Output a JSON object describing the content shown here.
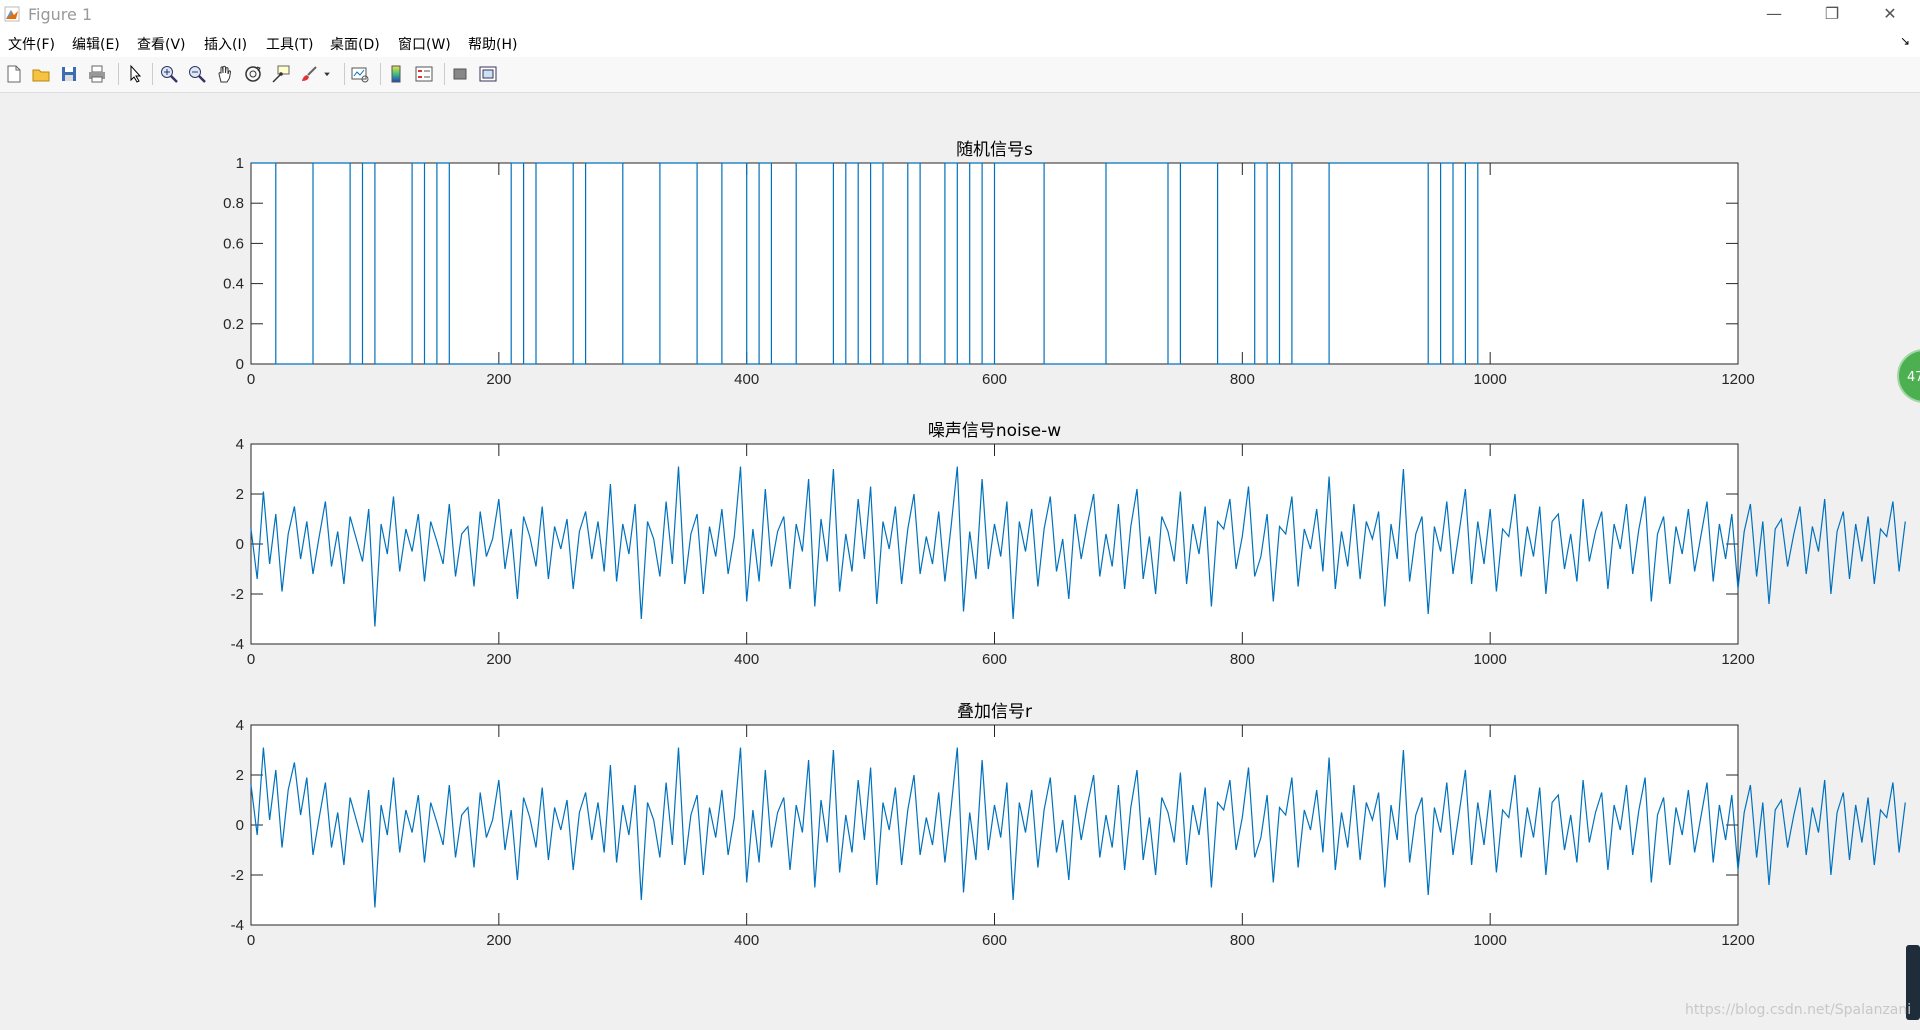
{
  "window": {
    "title": "Figure 1",
    "controls": [
      "—",
      "❐",
      "✕"
    ]
  },
  "menu": {
    "items": [
      "文件(F)",
      "编辑(E)",
      "查看(V)",
      "插入(I)",
      "工具(T)",
      "桌面(D)",
      "窗口(W)",
      "帮助(H)"
    ],
    "dock_arrow": "↘"
  },
  "toolbar": {
    "icons": [
      "new-figure-icon",
      "open-file-icon",
      "save-icon",
      "print-icon",
      "select-arrow-icon",
      "zoom-in-icon",
      "zoom-out-icon",
      "pan-hand-icon",
      "rotate-3d-icon",
      "data-cursor-icon",
      "brush-icon",
      "link-plot-icon",
      "colorbar-icon",
      "legend-icon",
      "hide-plot-tools-icon",
      "show-plot-tools-icon"
    ]
  },
  "overlay": {
    "badge": "47",
    "watermark": "https://blog.csdn.net/Spalanzani"
  },
  "chart_data": [
    {
      "type": "line",
      "title": "随机信号s",
      "xlim": [
        0,
        1200
      ],
      "ylim": [
        0,
        1
      ],
      "xticks": [
        "0",
        "200",
        "400",
        "600",
        "800",
        "1000",
        "1200"
      ],
      "yticks": [
        "0",
        "0.2",
        "0.4",
        "0.6",
        "0.8",
        "1"
      ],
      "color": "#0072bd",
      "step": true,
      "x": [
        0,
        20,
        50,
        80,
        90,
        100,
        130,
        140,
        150,
        160,
        210,
        220,
        230,
        260,
        270,
        300,
        330,
        360,
        380,
        400,
        410,
        420,
        440,
        470,
        480,
        490,
        500,
        510,
        530,
        540,
        560,
        570,
        580,
        590,
        600,
        640,
        690,
        740,
        750,
        780,
        810,
        820,
        830,
        840,
        870,
        950,
        960,
        970,
        980,
        990
      ],
      "y": [
        1,
        0,
        1,
        0,
        1,
        0,
        1,
        0,
        1,
        0,
        1,
        0,
        1,
        0,
        1,
        0,
        1,
        0,
        1,
        0,
        1,
        0,
        1,
        0,
        1,
        0,
        1,
        0,
        1,
        0,
        1,
        0,
        1,
        0,
        1,
        0,
        1,
        0,
        1,
        0,
        1,
        0,
        1,
        0,
        1,
        0,
        1,
        0,
        1,
        0
      ]
    },
    {
      "type": "line",
      "title": "噪声信号noise-w",
      "xlim": [
        0,
        1200
      ],
      "ylim": [
        -4,
        4
      ],
      "xticks": [
        "0",
        "200",
        "400",
        "600",
        "800",
        "1000",
        "1200"
      ],
      "yticks": [
        "-4",
        "-2",
        "0",
        "2",
        "4"
      ],
      "color": "#0072bd",
      "x_start": 0,
      "x_step": 5,
      "values": [
        0.6,
        -1.4,
        2.1,
        -0.8,
        1.2,
        -1.9,
        0.4,
        1.5,
        -0.6,
        0.9,
        -1.2,
        0.3,
        1.7,
        -0.9,
        0.5,
        -1.6,
        1.1,
        0.2,
        -0.7,
        1.4,
        -3.3,
        0.8,
        -0.4,
        1.9,
        -1.1,
        0.6,
        -0.3,
        1.2,
        -1.5,
        0.9,
        0.1,
        -0.8,
        1.6,
        -1.3,
        0.4,
        0.7,
        -1.7,
        1.3,
        -0.5,
        0.2,
        1.8,
        -1.0,
        0.6,
        -2.2,
        1.1,
        0.3,
        -0.9,
        1.5,
        -1.4,
        0.7,
        -0.2,
        1.0,
        -1.8,
        0.5,
        1.3,
        -0.6,
        0.9,
        -1.1,
        2.4,
        -1.5,
        0.8,
        -0.4,
        1.6,
        -3.0,
        0.9,
        0.2,
        -1.3,
        1.7,
        -0.8,
        3.1,
        -1.6,
        0.4,
        1.2,
        -2.0,
        0.7,
        -0.5,
        1.4,
        -1.2,
        0.3,
        3.1,
        -2.3,
        0.6,
        -1.5,
        2.2,
        -0.9,
        0.5,
        1.1,
        -1.8,
        0.8,
        -0.3,
        2.6,
        -2.5,
        1.0,
        -0.7,
        3.0,
        -1.9,
        0.4,
        -1.1,
        1.8,
        -0.6,
        2.3,
        -2.4,
        0.9,
        -0.2,
        1.5,
        -1.6,
        0.6,
        2.0,
        -1.2,
        0.3,
        -0.8,
        1.3,
        -1.5,
        0.7,
        3.1,
        -2.7,
        0.5,
        -1.4,
        2.6,
        -1.0,
        0.8,
        -0.5,
        1.7,
        -3.0,
        0.9,
        -0.3,
        1.4,
        -1.7,
        0.6,
        1.9,
        -1.1,
        0.2,
        -2.2,
        1.2,
        -0.6,
        0.8,
        2.0,
        -1.3,
        0.4,
        -0.9,
        1.6,
        -1.8,
        0.7,
        2.2,
        -1.4,
        0.3,
        -2.0,
        1.1,
        0.5,
        -0.7,
        2.1,
        -1.6,
        0.8,
        -0.4,
        1.5,
        -2.5,
        0.9,
        0.6,
        1.8,
        -1.0,
        0.3,
        2.3,
        -1.3,
        -0.5,
        1.2,
        -2.3,
        0.7,
        0.4,
        1.9,
        -1.7,
        0.6,
        -0.2,
        1.4,
        -1.1,
        2.7,
        -1.8,
        0.5,
        -0.9,
        1.6,
        -1.4,
        0.9,
        0.2,
        1.3,
        -2.5,
        0.8,
        -0.6,
        3.0,
        -1.5,
        0.4,
        1.1,
        -2.8,
        0.7,
        -0.3,
        1.7,
        -1.2,
        0.5,
        2.2,
        -1.6,
        0.9,
        -0.8,
        1.4,
        -1.9,
        0.6,
        0.3,
        2.0,
        -1.3,
        0.7,
        -0.5,
        1.5,
        -2.0,
        0.9,
        1.2,
        -1.0,
        0.4,
        -1.5,
        1.8,
        -0.7,
        0.5,
        1.3,
        -1.8,
        0.8,
        -0.2,
        1.6,
        -1.2,
        0.6,
        1.9,
        -2.3,
        0.4,
        1.1,
        -1.6,
        0.7,
        -0.4,
        1.4,
        -1.1,
        0.3,
        1.7,
        -1.5,
        0.8,
        -0.6,
        1.2,
        -1.8,
        0.5,
        1.6,
        -1.3,
        0.9,
        -2.4,
        0.6,
        1.0,
        -0.9,
        0.4,
        1.5,
        -1.2,
        0.7,
        -0.3,
        1.8,
        -2.0,
        0.5,
        1.3,
        -1.4,
        0.8,
        -0.7,
        1.1,
        -1.6,
        0.6,
        0.3,
        1.7,
        -1.1,
        0.9
      ]
    },
    {
      "type": "line",
      "title": "叠加信号r",
      "xlim": [
        0,
        1200
      ],
      "ylim": [
        -4,
        4
      ],
      "xticks": [
        "0",
        "200",
        "400",
        "600",
        "800",
        "1000",
        "1200"
      ],
      "yticks": [
        "-4",
        "-2",
        "0",
        "2",
        "4"
      ],
      "color": "#0072bd",
      "x_start": 0,
      "x_step": 5,
      "values": [
        1.6,
        -0.4,
        3.1,
        0.2,
        2.2,
        -0.9,
        1.4,
        2.5,
        0.4,
        1.9,
        -1.2,
        0.3,
        1.7,
        -0.9,
        0.5,
        -1.6,
        1.1,
        0.2,
        -0.7,
        1.4,
        -3.3,
        0.8,
        -0.4,
        1.9,
        -1.1,
        0.6,
        -0.3,
        1.2,
        -1.5,
        0.9,
        0.1,
        -0.8,
        1.6,
        -1.3,
        0.4,
        0.7,
        -1.7,
        1.3,
        -0.5,
        0.2,
        1.8,
        -1.0,
        0.6,
        -2.2,
        1.1,
        0.3,
        -0.9,
        1.5,
        -1.4,
        0.7,
        -0.2,
        1.0,
        -1.8,
        0.5,
        1.3,
        -0.6,
        0.9,
        -1.1,
        2.4,
        -1.5,
        0.8,
        -0.4,
        1.6,
        -3.0,
        0.9,
        0.2,
        -1.3,
        1.7,
        -0.8,
        3.1,
        -1.6,
        0.4,
        1.2,
        -2.0,
        0.7,
        -0.5,
        1.4,
        -1.2,
        0.3,
        3.1,
        -2.3,
        0.6,
        -1.5,
        2.2,
        -0.9,
        0.5,
        1.1,
        -1.8,
        0.8,
        -0.3,
        2.6,
        -2.5,
        1.0,
        -0.7,
        3.0,
        -1.9,
        0.4,
        -1.1,
        1.8,
        -0.6,
        2.3,
        -2.4,
        0.9,
        -0.2,
        1.5,
        -1.6,
        0.6,
        2.0,
        -1.2,
        0.3,
        -0.8,
        1.3,
        -1.5,
        0.7,
        3.1,
        -2.7,
        0.5,
        -1.4,
        2.6,
        -1.0,
        0.8,
        -0.5,
        1.7,
        -3.0,
        0.9,
        -0.3,
        1.4,
        -1.7,
        0.6,
        1.9,
        -1.1,
        0.2,
        -2.2,
        1.2,
        -0.6,
        0.8,
        2.0,
        -1.3,
        0.4,
        -0.9,
        1.6,
        -1.8,
        0.7,
        2.2,
        -1.4,
        0.3,
        -2.0,
        1.1,
        0.5,
        -0.7,
        2.1,
        -1.6,
        0.8,
        -0.4,
        1.5,
        -2.5,
        0.9,
        0.6,
        1.8,
        -1.0,
        0.3,
        2.3,
        -1.3,
        -0.5,
        1.2,
        -2.3,
        0.7,
        0.4,
        1.9,
        -1.7,
        0.6,
        -0.2,
        1.4,
        -1.1,
        2.7,
        -1.8,
        0.5,
        -0.9,
        1.6,
        -1.4,
        0.9,
        0.2,
        1.3,
        -2.5,
        0.8,
        -0.6,
        3.0,
        -1.5,
        0.4,
        1.1,
        -2.8,
        0.7,
        -0.3,
        1.7,
        -1.2,
        0.5,
        2.2,
        -1.6,
        0.9,
        -0.8,
        1.4,
        -1.9,
        0.6,
        0.3,
        2.0,
        -1.3,
        0.7,
        -0.5,
        1.5,
        -2.0,
        0.9,
        1.2,
        -1.0,
        0.4,
        -1.5,
        1.8,
        -0.7,
        0.5,
        1.3,
        -1.8,
        0.8,
        -0.2,
        1.6,
        -1.2,
        0.6,
        1.9,
        -2.3,
        0.4,
        1.1,
        -1.6,
        0.7,
        -0.4,
        1.4,
        -1.1,
        0.3,
        1.7,
        -1.5,
        0.8,
        -0.6,
        1.2,
        -1.8,
        0.5,
        1.6,
        -1.3,
        0.9,
        -2.4,
        0.6,
        1.0,
        -0.9,
        0.4,
        1.5,
        -1.2,
        0.7,
        -0.3,
        1.8,
        -2.0,
        0.5,
        1.3,
        -1.4,
        0.8,
        -0.7,
        1.1,
        -1.6,
        0.6,
        0.3,
        1.7,
        -1.1,
        0.9
      ]
    }
  ]
}
